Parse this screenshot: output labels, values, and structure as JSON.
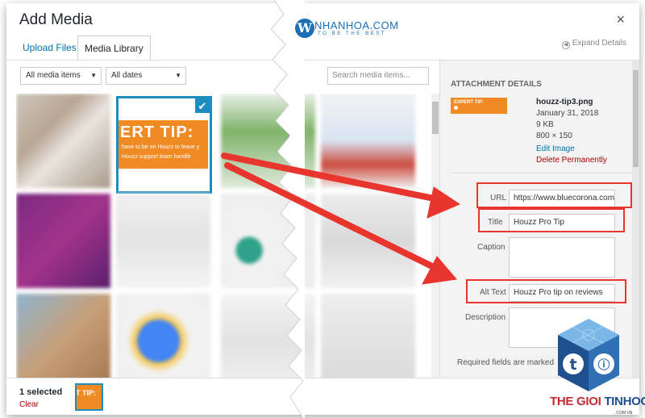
{
  "dialog": {
    "title": "Add Media",
    "close_glyph": "×",
    "tabs": [
      {
        "label": "Upload Files"
      },
      {
        "label": "Media Library"
      }
    ],
    "expand_label": "Expand Details"
  },
  "filters": {
    "type_selected": "All media items",
    "date_selected": "All dates",
    "search_placeholder": "Search media items..."
  },
  "selected_item": {
    "banner_title": "ERT TIP:",
    "banner_line1": "have to be on Houzz to leave y",
    "banner_line2": "Houzz support team handle",
    "check_glyph": "✔"
  },
  "details": {
    "heading": "ATTACHMENT DETAILS",
    "thumb_label": "EXPERT TIP:",
    "filename": "houzz-tip3.png",
    "date": "January 31, 2018",
    "size": "9 KB",
    "dimensions": "800 × 150",
    "edit_link": "Edit Image",
    "delete_link": "Delete Permanently",
    "fields": {
      "url_label": "URL",
      "url_value": "https://www.bluecorona.com",
      "title_label": "Title",
      "title_value": "Houzz Pro Tip",
      "caption_label": "Caption",
      "caption_value": "",
      "alt_label": "Alt Text",
      "alt_value": "Houzz Pro tip on reviews",
      "description_label": "Description",
      "description_value": ""
    },
    "required_note": "Required fields are marked"
  },
  "footer": {
    "selected_count": "1 selected",
    "clear_label": "Clear",
    "thumb_label": "T TIP:"
  },
  "watermark_top": {
    "glyph": "W",
    "name": "NHANHOA.COM",
    "slogan": "TO BE THE BEST"
  },
  "watermark_bottom": {
    "name_part1": "THE GIOI",
    "name_part2": "TINHOC",
    "url": ".COM.VN"
  },
  "colors": {
    "accent": "#1e8cbe",
    "link": "#0073aa",
    "danger": "#a00000",
    "banner_orange": "#f08a22",
    "arrow_red": "#e8352d"
  },
  "icons": [
    "close-icon",
    "expand-icon",
    "chevron-down-icon",
    "checkmark-icon",
    "arrow-icon"
  ]
}
